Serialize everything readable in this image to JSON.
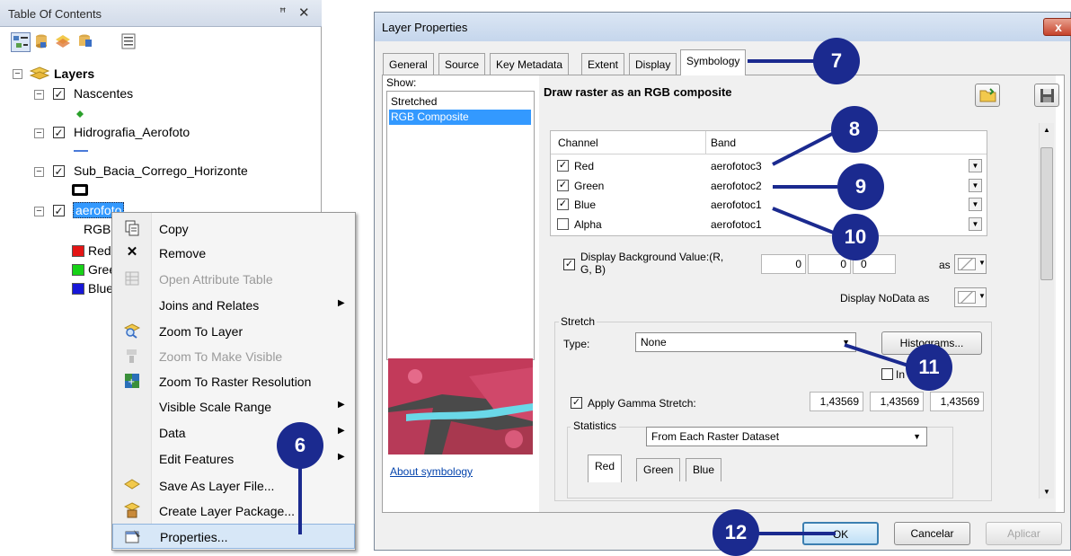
{
  "toc": {
    "title": "Table Of Contents",
    "pin_glyph": "ꟸ",
    "close_glyph": "✕",
    "root_label": "Layers",
    "layers": [
      {
        "name": "Nascentes"
      },
      {
        "name": "Hidrografia_Aerofoto"
      },
      {
        "name": "Sub_Bacia_Corrego_Horizonte"
      },
      {
        "name": "aerofoto"
      }
    ],
    "rgb_label": "RGB",
    "rgb_items": [
      {
        "label": "Red:",
        "color": "#e41515"
      },
      {
        "label": "Greer",
        "color": "#17d217"
      },
      {
        "label": "Blue:",
        "color": "#1717d8"
      }
    ]
  },
  "context_menu": {
    "items": [
      {
        "label": "Copy",
        "icon": "copy-icon",
        "disabled": false,
        "submenu": false
      },
      {
        "label": "Remove",
        "icon": "remove-icon",
        "disabled": false,
        "submenu": false
      },
      {
        "label": "Open Attribute Table",
        "icon": "table-icon",
        "disabled": true,
        "submenu": false
      },
      {
        "label": "Joins and Relates",
        "icon": "",
        "disabled": false,
        "submenu": true
      },
      {
        "label": "Zoom To Layer",
        "icon": "zoom-layer-icon",
        "disabled": false,
        "submenu": false
      },
      {
        "label": "Zoom To Make Visible",
        "icon": "zoom-visible-icon",
        "disabled": true,
        "submenu": false
      },
      {
        "label": "Zoom To Raster Resolution",
        "icon": "zoom-raster-icon",
        "disabled": false,
        "submenu": false
      },
      {
        "label": "Visible Scale Range",
        "icon": "",
        "disabled": false,
        "submenu": true
      },
      {
        "label": "Data",
        "icon": "",
        "disabled": false,
        "submenu": true
      },
      {
        "label": "Edit Features",
        "icon": "",
        "disabled": false,
        "submenu": true
      },
      {
        "label": "Save As Layer File...",
        "icon": "layer-file-icon",
        "disabled": false,
        "submenu": false
      },
      {
        "label": "Create Layer Package...",
        "icon": "layer-package-icon",
        "disabled": false,
        "submenu": false
      },
      {
        "label": "Properties...",
        "icon": "properties-icon",
        "disabled": false,
        "submenu": false
      }
    ]
  },
  "dialog": {
    "title": "Layer Properties",
    "close_glyph": "x",
    "tabs": [
      "General",
      "Source",
      "Key Metadata",
      "Extent",
      "Display",
      "Symbology"
    ],
    "show_label": "Show:",
    "show_items": [
      "Stretched",
      "RGB Composite"
    ],
    "heading": "Draw raster as an RGB composite",
    "channel_header": "Channel",
    "band_header": "Band",
    "channels": [
      {
        "name": "Red",
        "band": "aerofotoc3",
        "checked": true
      },
      {
        "name": "Green",
        "band": "aerofotoc2",
        "checked": true
      },
      {
        "name": "Blue",
        "band": "aerofotoc1",
        "checked": true
      },
      {
        "name": "Alpha",
        "band": "aerofotoc1",
        "checked": false
      }
    ],
    "bg_label_1": "Display Background Value:(R,",
    "bg_label_2": "G, B)",
    "bg_values": [
      "0",
      "0",
      "0"
    ],
    "as_label": "as",
    "nodata_label": "Display NoData as",
    "stretch_label": "Stretch",
    "type_label": "Type:",
    "type_value": "None",
    "histograms_label": "Histograms...",
    "invert_label": "In",
    "gamma_label": "Apply Gamma Stretch:",
    "gamma_values": [
      "1,43569",
      "1,43569",
      "1,43569"
    ],
    "statistics_label": "Statistics",
    "statistics_value": "From Each Raster Dataset",
    "subtabs": [
      "Red",
      "Green",
      "Blue"
    ],
    "about_link": "About symbology",
    "buttons": {
      "ok": "OK",
      "cancel": "Cancelar",
      "apply": "Aplicar"
    }
  },
  "callouts": [
    "6",
    "7",
    "8",
    "9",
    "10",
    "11",
    "12"
  ],
  "colors": {
    "callout": "#1b2a8f",
    "selection": "#3399ff",
    "highlight": "#d7e7f7"
  }
}
